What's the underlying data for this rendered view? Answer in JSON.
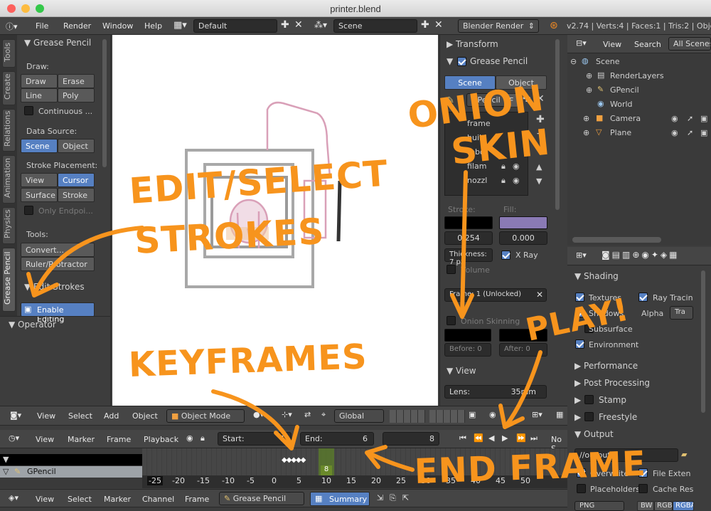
{
  "window": {
    "title": "printer.blend"
  },
  "info_bar": {
    "menus": [
      "File",
      "Render",
      "Window",
      "Help"
    ],
    "screen_layout": "Default",
    "scene": "Scene",
    "engine": "Blender Render",
    "stats": "v2.74 | Verts:4 | Faces:1 | Tris:2 | Objects"
  },
  "toolshelf": {
    "tabs": [
      "Tools",
      "Create",
      "Relations",
      "Animation",
      "Physics",
      "Grease Pencil"
    ],
    "panel_title": "Grease Pencil",
    "draw_label": "Draw:",
    "draw": "Draw",
    "erase": "Erase",
    "line": "Line",
    "poly": "Poly",
    "continuous": "Continuous ...",
    "data_source_label": "Data Source:",
    "scene": "Scene",
    "object": "Object",
    "stroke_placement_label": "Stroke Placement:",
    "view": "View",
    "cursor": "Cursor",
    "surface": "Surface",
    "stroke": "Stroke",
    "only_endpoints": "Only Endpoi...",
    "tools_label": "Tools:",
    "convert": "Convert...",
    "ruler": "Ruler/Protractor",
    "edit_strokes": "Edit Strokes",
    "enable_editing": "Enable Editing",
    "operator": "Operator"
  },
  "properties_n": {
    "transform": "Transform",
    "grease_pencil": "Grease Pencil",
    "scene": "Scene",
    "object": "Object",
    "gpencil_name": "GPencil",
    "f": "F",
    "layers": [
      "frame",
      "build",
      "robot",
      "filam",
      "nozzl"
    ],
    "stroke_label": "Stroke:",
    "fill_label": "Fill:",
    "stroke_val": "0.254",
    "fill_val": "0.000",
    "thickness": "Thickness: 7 px",
    "xray": "X Ray",
    "volume": "Volume",
    "frame_unlocked": "Frame: 1 (Unlocked)",
    "onion_skinning": "Onion Skinning",
    "before": "Before: 0",
    "after": "After: 0",
    "view_panel": "View",
    "lens": "Lens:",
    "lens_val": "35mm"
  },
  "outliner": {
    "view": "View",
    "search": "Search",
    "all_scenes": "All Scenes",
    "items": [
      "Scene",
      "RenderLayers",
      "GPencil",
      "World",
      "Camera",
      "Plane"
    ]
  },
  "render_props": {
    "shading": "Shading",
    "textures": "Textures",
    "ray_tracing": "Ray Tracin",
    "shadows": "Shadows",
    "alpha": "Alpha",
    "alpha_val": "Tra",
    "subsurface": "Subsurface",
    "environment": "Environment",
    "performance": "Performance",
    "post_processing": "Post Processing",
    "stamp": "Stamp",
    "freestyle": "Freestyle",
    "output": "Output",
    "output_path": "//output/",
    "overwrite": "Overwrite",
    "file_ext": "File Exten",
    "placeholders": "Placeholders",
    "cache_res": "Cache Res",
    "png": "PNG",
    "bw": "BW",
    "rgb": "RGB",
    "rgba": "RGBA"
  },
  "viewport_header": {
    "view": "View",
    "select": "Select",
    "add": "Add",
    "object": "Object",
    "mode": "Object Mode",
    "orientation": "Global"
  },
  "timeline": {
    "view": "View",
    "marker": "Marker",
    "frame": "Frame",
    "playback": "Playback",
    "start_label": "Start:",
    "start": "1",
    "end_label": "End:",
    "end": "6",
    "current": "8",
    "no_sync": "No S"
  },
  "dopesheet": {
    "channel": "GPencil",
    "current_frame": "8",
    "ticks": [
      "-25",
      "-20",
      "-15",
      "-10",
      "-5",
      "0",
      "5",
      "10",
      "15",
      "20",
      "25",
      "30",
      "35",
      "40",
      "45",
      "50"
    ],
    "view": "View",
    "select": "Select",
    "marker": "Marker",
    "channel_menu": "Channel",
    "frame": "Frame",
    "mode": "Grease Pencil",
    "summary": "Summary"
  },
  "annotations": {
    "edit_select_1": "EDIT/SELECT",
    "edit_select_2": "STROKES",
    "onion_1": "ONION",
    "onion_2": "SKIN",
    "keyframes": "KEYFRAMES",
    "play": "PLAY!",
    "end_frame": "END FRAME"
  },
  "colors": {
    "accent": "#5680c2",
    "annotation": "#f7941d",
    "current_frame": "#6a8a2a"
  }
}
